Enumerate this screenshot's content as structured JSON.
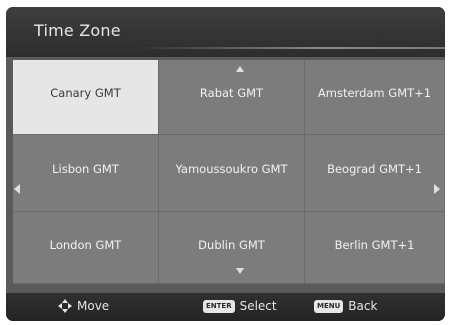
{
  "header": {
    "title": "Time Zone"
  },
  "zones": [
    [
      "Canary GMT",
      "Rabat GMT",
      "Amsterdam GMT+1"
    ],
    [
      "Lisbon GMT",
      "Yamoussoukro GMT",
      "Beograd GMT+1"
    ],
    [
      "London GMT",
      "Dublin GMT",
      "Berlin GMT+1"
    ]
  ],
  "selected_zone": "Canary GMT",
  "footer": {
    "move_label": "Move",
    "select_key": "ENTER",
    "select_label": "Select",
    "back_key": "MENU",
    "back_label": "Back"
  },
  "colors": {
    "cell": "#7c7c7c",
    "selected_cell": "#e6e6e6",
    "bar": "#2d2d2d"
  }
}
